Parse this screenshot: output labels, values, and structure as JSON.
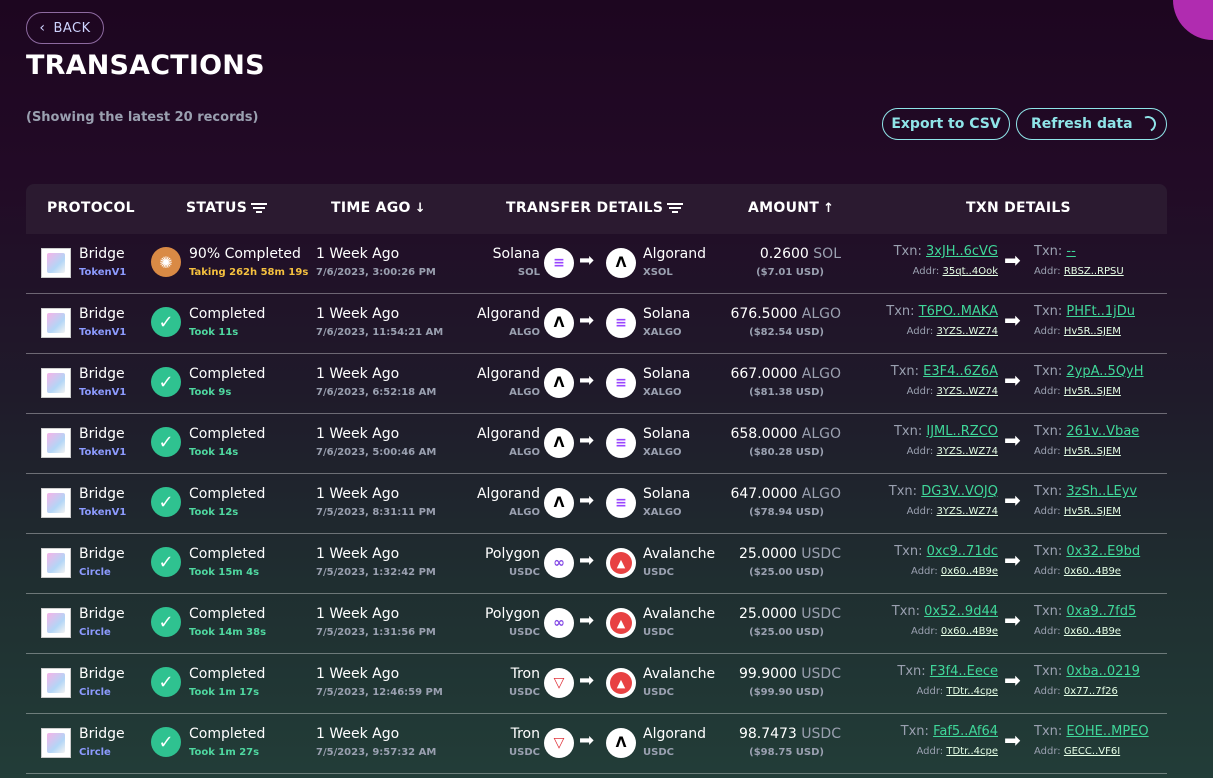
{
  "header": {
    "back_label": "BACK",
    "title": "TRANSACTIONS",
    "subtitle": "(Showing the latest 20 records)",
    "export_label": "Export to CSV",
    "refresh_label": "Refresh data"
  },
  "columns": {
    "protocol": "PROTOCOL",
    "status": "STATUS",
    "time_ago": "TIME AGO",
    "transfer_details": "TRANSFER DETAILS",
    "amount": "AMOUNT",
    "txn_details": "TXN DETAILS"
  },
  "colors": {
    "accent": "#8fe4e8",
    "success": "#2fc290",
    "pending": "#d98a45",
    "link": "#3fd89a",
    "version": "#8d9bff"
  },
  "rows": [
    {
      "protocol": "Bridge",
      "version": "TokenV1",
      "status": "90% Completed",
      "status_sub": "Taking 262h 58m 19s",
      "pending": true,
      "time_ago": "1 Week Ago",
      "date": "7/6/2023, 3:00:26 PM",
      "from_chain": "Solana",
      "from_token": "SOL",
      "from_icon": "solana-icon",
      "to_chain": "Algorand",
      "to_token": "XSOL",
      "to_icon": "algorand-icon",
      "amount": "0.2600",
      "unit": "SOL",
      "usd": "($7.01 USD)",
      "txn_label": "Txn:",
      "addr_label": "Addr:",
      "txn_from": "3xJH..6cVG",
      "addr_from": "35qt..4Ook",
      "txn_to": "--",
      "addr_to": "RBSZ..RPSU"
    },
    {
      "protocol": "Bridge",
      "version": "TokenV1",
      "status": "Completed",
      "status_sub": "Took 11s",
      "pending": false,
      "time_ago": "1 Week Ago",
      "date": "7/6/2023, 11:54:21 AM",
      "from_chain": "Algorand",
      "from_token": "ALGO",
      "from_icon": "algorand-icon",
      "to_chain": "Solana",
      "to_token": "XALGO",
      "to_icon": "solana-icon",
      "amount": "676.5000",
      "unit": "ALGO",
      "usd": "($82.54 USD)",
      "txn_label": "Txn:",
      "addr_label": "Addr:",
      "txn_from": "T6PO..MAKA",
      "addr_from": "3YZS..WZ74",
      "txn_to": "PHFt..1jDu",
      "addr_to": "Hv5R..SJEM"
    },
    {
      "protocol": "Bridge",
      "version": "TokenV1",
      "status": "Completed",
      "status_sub": "Took 9s",
      "pending": false,
      "time_ago": "1 Week Ago",
      "date": "7/6/2023, 6:52:18 AM",
      "from_chain": "Algorand",
      "from_token": "ALGO",
      "from_icon": "algorand-icon",
      "to_chain": "Solana",
      "to_token": "XALGO",
      "to_icon": "solana-icon",
      "amount": "667.0000",
      "unit": "ALGO",
      "usd": "($81.38 USD)",
      "txn_label": "Txn:",
      "addr_label": "Addr:",
      "txn_from": "E3F4..6Z6A",
      "addr_from": "3YZS..WZ74",
      "txn_to": "2ypA..5QyH",
      "addr_to": "Hv5R..SJEM"
    },
    {
      "protocol": "Bridge",
      "version": "TokenV1",
      "status": "Completed",
      "status_sub": "Took 14s",
      "pending": false,
      "time_ago": "1 Week Ago",
      "date": "7/6/2023, 5:00:46 AM",
      "from_chain": "Algorand",
      "from_token": "ALGO",
      "from_icon": "algorand-icon",
      "to_chain": "Solana",
      "to_token": "XALGO",
      "to_icon": "solana-icon",
      "amount": "658.0000",
      "unit": "ALGO",
      "usd": "($80.28 USD)",
      "txn_label": "Txn:",
      "addr_label": "Addr:",
      "txn_from": "IJML..RZCO",
      "addr_from": "3YZS..WZ74",
      "txn_to": "261v..Vbae",
      "addr_to": "Hv5R..SJEM"
    },
    {
      "protocol": "Bridge",
      "version": "TokenV1",
      "status": "Completed",
      "status_sub": "Took 12s",
      "pending": false,
      "time_ago": "1 Week Ago",
      "date": "7/5/2023, 8:31:11 PM",
      "from_chain": "Algorand",
      "from_token": "ALGO",
      "from_icon": "algorand-icon",
      "to_chain": "Solana",
      "to_token": "XALGO",
      "to_icon": "solana-icon",
      "amount": "647.0000",
      "unit": "ALGO",
      "usd": "($78.94 USD)",
      "txn_label": "Txn:",
      "addr_label": "Addr:",
      "txn_from": "DG3V..VOJQ",
      "addr_from": "3YZS..WZ74",
      "txn_to": "3zSh..LEyv",
      "addr_to": "Hv5R..SJEM"
    },
    {
      "protocol": "Bridge",
      "version": "Circle",
      "status": "Completed",
      "status_sub": "Took 15m 4s",
      "pending": false,
      "time_ago": "1 Week Ago",
      "date": "7/5/2023, 1:32:42 PM",
      "from_chain": "Polygon",
      "from_token": "USDC",
      "from_icon": "polygon-icon",
      "to_chain": "Avalanche",
      "to_token": "USDC",
      "to_icon": "avalanche-icon",
      "amount": "25.0000",
      "unit": "USDC",
      "usd": "($25.00 USD)",
      "txn_label": "Txn:",
      "addr_label": "Addr:",
      "txn_from": "0xc9..71dc",
      "addr_from": "0x60..4B9e",
      "txn_to": "0x32..E9bd",
      "addr_to": "0x60..4B9e"
    },
    {
      "protocol": "Bridge",
      "version": "Circle",
      "status": "Completed",
      "status_sub": "Took 14m 38s",
      "pending": false,
      "time_ago": "1 Week Ago",
      "date": "7/5/2023, 1:31:56 PM",
      "from_chain": "Polygon",
      "from_token": "USDC",
      "from_icon": "polygon-icon",
      "to_chain": "Avalanche",
      "to_token": "USDC",
      "to_icon": "avalanche-icon",
      "amount": "25.0000",
      "unit": "USDC",
      "usd": "($25.00 USD)",
      "txn_label": "Txn:",
      "addr_label": "Addr:",
      "txn_from": "0x52..9d44",
      "addr_from": "0x60..4B9e",
      "txn_to": "0xa9..7fd5",
      "addr_to": "0x60..4B9e"
    },
    {
      "protocol": "Bridge",
      "version": "Circle",
      "status": "Completed",
      "status_sub": "Took 1m 17s",
      "pending": false,
      "time_ago": "1 Week Ago",
      "date": "7/5/2023, 12:46:59 PM",
      "from_chain": "Tron",
      "from_token": "USDC",
      "from_icon": "tron-icon",
      "to_chain": "Avalanche",
      "to_token": "USDC",
      "to_icon": "avalanche-icon",
      "amount": "99.9000",
      "unit": "USDC",
      "usd": "($99.90 USD)",
      "txn_label": "Txn:",
      "addr_label": "Addr:",
      "txn_from": "F3f4..Eece",
      "addr_from": "TDtr..4cpe",
      "txn_to": "0xba..0219",
      "addr_to": "0x77..7f26"
    },
    {
      "protocol": "Bridge",
      "version": "Circle",
      "status": "Completed",
      "status_sub": "Took 1m 27s",
      "pending": false,
      "time_ago": "1 Week Ago",
      "date": "7/5/2023, 9:57:32 AM",
      "from_chain": "Tron",
      "from_token": "USDC",
      "from_icon": "tron-icon",
      "to_chain": "Algorand",
      "to_token": "USDC",
      "to_icon": "algorand-icon",
      "amount": "98.7473",
      "unit": "USDC",
      "usd": "($98.75 USD)",
      "txn_label": "Txn:",
      "addr_label": "Addr:",
      "txn_from": "Faf5..Af64",
      "addr_from": "TDtr..4cpe",
      "txn_to": "EOHE..MPEO",
      "addr_to": "GECC..VF6I"
    }
  ]
}
